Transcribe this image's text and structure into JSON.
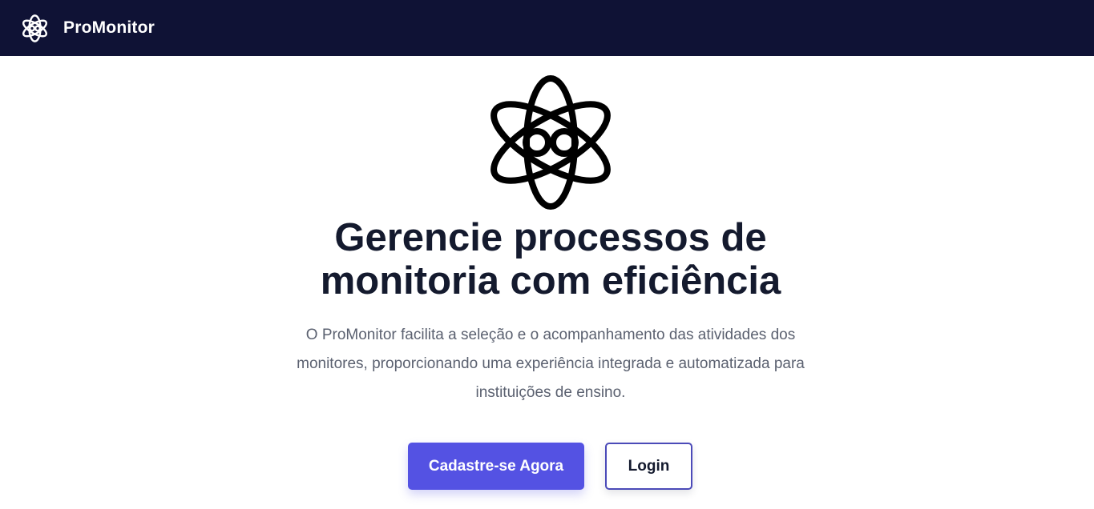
{
  "header": {
    "brand": "ProMonitor",
    "logo_icon": "atom-glasses-icon"
  },
  "hero": {
    "logo_icon": "atom-glasses-icon",
    "title_line1": "Gerencie processos de",
    "title_line2": "monitoria com eficiência",
    "subtitle_line1": "O ProMonitor facilita a seleção e o acompanhamento das atividades dos",
    "subtitle_line2": "monitores, proporcionando uma experiência integrada e automatizada para",
    "subtitle_line3": "instituições de ensino.",
    "primary_button": "Cadastre-se Agora",
    "secondary_button": "Login"
  },
  "colors": {
    "navbar_bg": "#0f1235",
    "primary": "#5452e3",
    "title": "#141a2e",
    "subtitle": "#5b6170"
  }
}
